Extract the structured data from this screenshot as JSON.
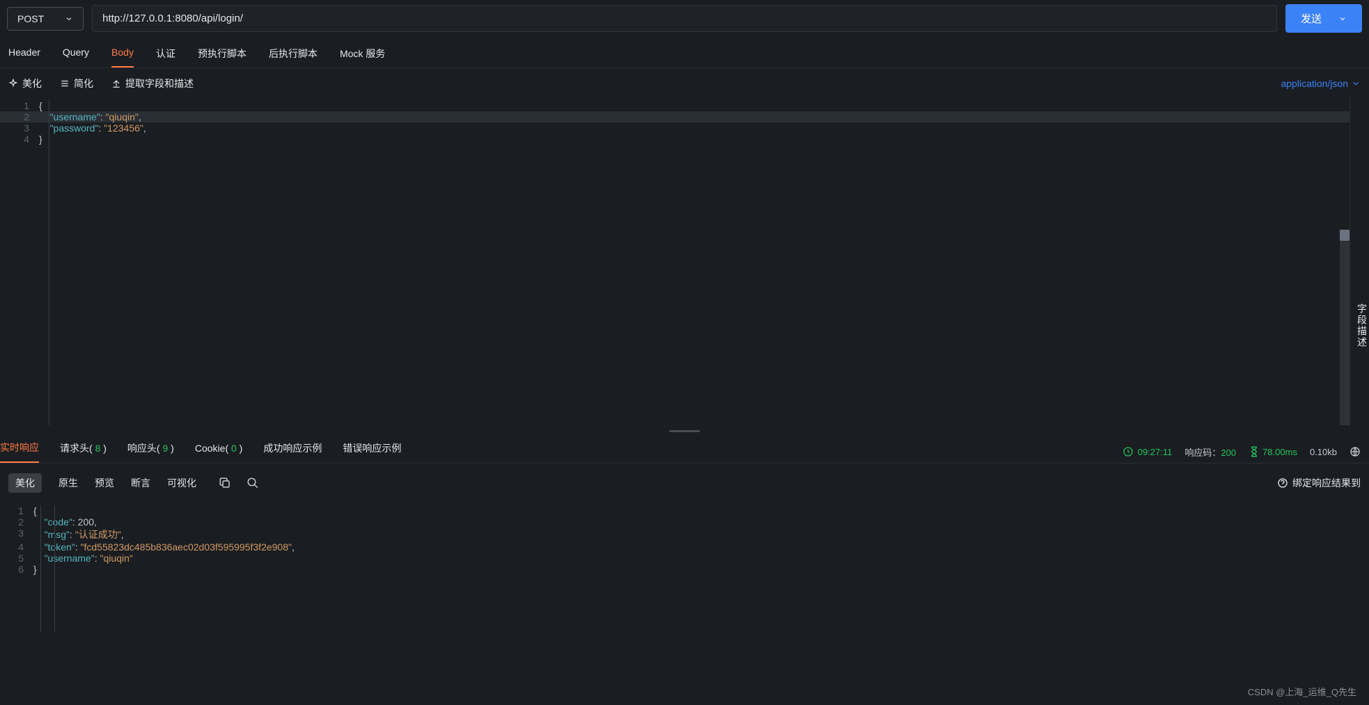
{
  "method": "POST",
  "url": "http://127.0.0.1:8080/api/login/",
  "send_label": "发送",
  "request_tabs": [
    "Header",
    "Query",
    "Body",
    "认证",
    "预执行脚本",
    "后执行脚本",
    "Mock 服务"
  ],
  "active_request_tab": "Body",
  "body_tools": {
    "beautify": "美化",
    "simplify": "简化",
    "extract": "提取字段和描述"
  },
  "content_type": "application/json",
  "side_panel_label": "字段描述",
  "request_body": {
    "1": "{",
    "2": {
      "indent": "    ",
      "key": "\"username\"",
      "sep": ": ",
      "val": "\"qiuqin\"",
      "tail": ","
    },
    "3": {
      "indent": "    ",
      "key": "\"password\"",
      "sep": ": ",
      "val": "\"123456\"",
      "tail": ","
    },
    "4": "}"
  },
  "response_tabs": {
    "realtime": "实时响应",
    "req_headers": {
      "label": "请求头",
      "count": "8"
    },
    "resp_headers": {
      "label": "响应头",
      "count": "9"
    },
    "cookie": {
      "label": "Cookie",
      "count": "0"
    },
    "success_example": "成功响应示例",
    "error_example": "错误响应示例"
  },
  "response_meta": {
    "time": "09:27:11",
    "status_label": "响应码：",
    "status_code": "200",
    "duration": "78.00ms",
    "size": "0.10kb"
  },
  "view_tabs": [
    "美化",
    "原生",
    "预览",
    "断言",
    "可视化"
  ],
  "bind_label": "绑定响应结果到",
  "response_body": {
    "1": "{",
    "2": {
      "indent": "    ",
      "key": "\"code\"",
      "sep": ": ",
      "val": "200",
      "type": "num",
      "tail": ","
    },
    "3": {
      "indent": "    ",
      "key": "\"msg\"",
      "sep": ": ",
      "val": "\"认证成功\"",
      "type": "str",
      "tail": ","
    },
    "4": {
      "indent": "    ",
      "key": "\"token\"",
      "sep": ": ",
      "val": "\"fcd55823dc485b836aec02d03f595995f3f2e908\"",
      "type": "str",
      "tail": ","
    },
    "5": {
      "indent": "    ",
      "key": "\"username\"",
      "sep": ": ",
      "val": "\"qiuqin\"",
      "type": "str",
      "tail": ""
    },
    "6": "}"
  },
  "footer": "CSDN @上海_运维_Q先生"
}
